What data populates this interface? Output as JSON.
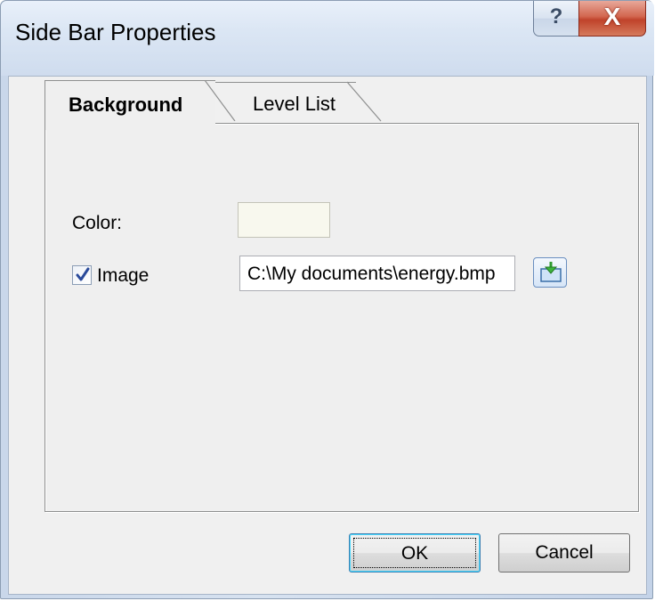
{
  "window": {
    "title": "Side Bar Properties",
    "help_glyph": "?",
    "close_glyph": "X"
  },
  "tabs": [
    {
      "label": "Background",
      "active": true
    },
    {
      "label": "Level List",
      "active": false
    }
  ],
  "background_tab": {
    "color_label": "Color:",
    "color_value": "#f8f8ee",
    "image_label": "Image",
    "image_checked": true,
    "image_path": "C:\\My documents\\energy.bmp",
    "browse_icon": "open-file-icon"
  },
  "buttons": {
    "ok": "OK",
    "cancel": "Cancel"
  },
  "colors": {
    "accent": "#3c7fb1",
    "close": "#c0432b"
  }
}
